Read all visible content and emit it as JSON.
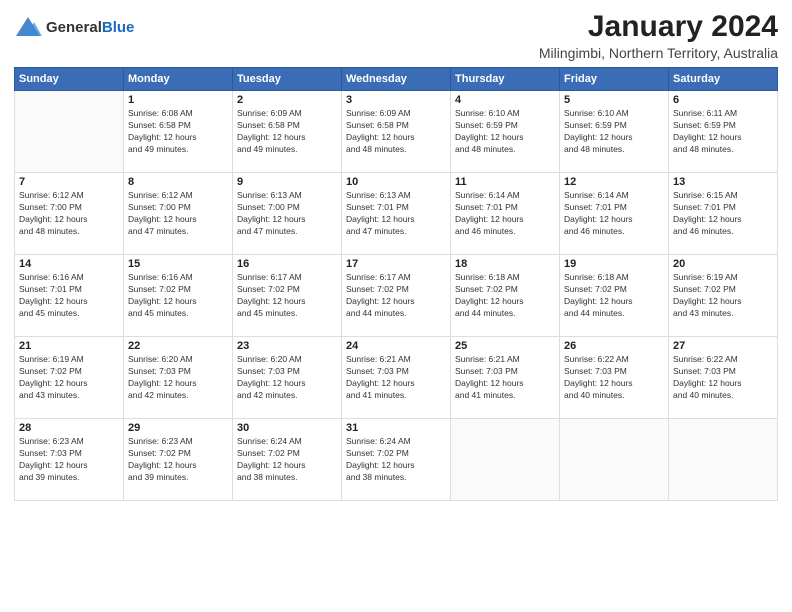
{
  "logo": {
    "general": "General",
    "blue": "Blue"
  },
  "title": "January 2024",
  "location": "Milingimbi, Northern Territory, Australia",
  "days_of_week": [
    "Sunday",
    "Monday",
    "Tuesday",
    "Wednesday",
    "Thursday",
    "Friday",
    "Saturday"
  ],
  "weeks": [
    [
      {
        "day": "",
        "info": ""
      },
      {
        "day": "1",
        "info": "Sunrise: 6:08 AM\nSunset: 6:58 PM\nDaylight: 12 hours\nand 49 minutes."
      },
      {
        "day": "2",
        "info": "Sunrise: 6:09 AM\nSunset: 6:58 PM\nDaylight: 12 hours\nand 49 minutes."
      },
      {
        "day": "3",
        "info": "Sunrise: 6:09 AM\nSunset: 6:58 PM\nDaylight: 12 hours\nand 48 minutes."
      },
      {
        "day": "4",
        "info": "Sunrise: 6:10 AM\nSunset: 6:59 PM\nDaylight: 12 hours\nand 48 minutes."
      },
      {
        "day": "5",
        "info": "Sunrise: 6:10 AM\nSunset: 6:59 PM\nDaylight: 12 hours\nand 48 minutes."
      },
      {
        "day": "6",
        "info": "Sunrise: 6:11 AM\nSunset: 6:59 PM\nDaylight: 12 hours\nand 48 minutes."
      }
    ],
    [
      {
        "day": "7",
        "info": "Sunrise: 6:12 AM\nSunset: 7:00 PM\nDaylight: 12 hours\nand 48 minutes."
      },
      {
        "day": "8",
        "info": "Sunrise: 6:12 AM\nSunset: 7:00 PM\nDaylight: 12 hours\nand 47 minutes."
      },
      {
        "day": "9",
        "info": "Sunrise: 6:13 AM\nSunset: 7:00 PM\nDaylight: 12 hours\nand 47 minutes."
      },
      {
        "day": "10",
        "info": "Sunrise: 6:13 AM\nSunset: 7:01 PM\nDaylight: 12 hours\nand 47 minutes."
      },
      {
        "day": "11",
        "info": "Sunrise: 6:14 AM\nSunset: 7:01 PM\nDaylight: 12 hours\nand 46 minutes."
      },
      {
        "day": "12",
        "info": "Sunrise: 6:14 AM\nSunset: 7:01 PM\nDaylight: 12 hours\nand 46 minutes."
      },
      {
        "day": "13",
        "info": "Sunrise: 6:15 AM\nSunset: 7:01 PM\nDaylight: 12 hours\nand 46 minutes."
      }
    ],
    [
      {
        "day": "14",
        "info": "Sunrise: 6:16 AM\nSunset: 7:01 PM\nDaylight: 12 hours\nand 45 minutes."
      },
      {
        "day": "15",
        "info": "Sunrise: 6:16 AM\nSunset: 7:02 PM\nDaylight: 12 hours\nand 45 minutes."
      },
      {
        "day": "16",
        "info": "Sunrise: 6:17 AM\nSunset: 7:02 PM\nDaylight: 12 hours\nand 45 minutes."
      },
      {
        "day": "17",
        "info": "Sunrise: 6:17 AM\nSunset: 7:02 PM\nDaylight: 12 hours\nand 44 minutes."
      },
      {
        "day": "18",
        "info": "Sunrise: 6:18 AM\nSunset: 7:02 PM\nDaylight: 12 hours\nand 44 minutes."
      },
      {
        "day": "19",
        "info": "Sunrise: 6:18 AM\nSunset: 7:02 PM\nDaylight: 12 hours\nand 44 minutes."
      },
      {
        "day": "20",
        "info": "Sunrise: 6:19 AM\nSunset: 7:02 PM\nDaylight: 12 hours\nand 43 minutes."
      }
    ],
    [
      {
        "day": "21",
        "info": "Sunrise: 6:19 AM\nSunset: 7:02 PM\nDaylight: 12 hours\nand 43 minutes."
      },
      {
        "day": "22",
        "info": "Sunrise: 6:20 AM\nSunset: 7:03 PM\nDaylight: 12 hours\nand 42 minutes."
      },
      {
        "day": "23",
        "info": "Sunrise: 6:20 AM\nSunset: 7:03 PM\nDaylight: 12 hours\nand 42 minutes."
      },
      {
        "day": "24",
        "info": "Sunrise: 6:21 AM\nSunset: 7:03 PM\nDaylight: 12 hours\nand 41 minutes."
      },
      {
        "day": "25",
        "info": "Sunrise: 6:21 AM\nSunset: 7:03 PM\nDaylight: 12 hours\nand 41 minutes."
      },
      {
        "day": "26",
        "info": "Sunrise: 6:22 AM\nSunset: 7:03 PM\nDaylight: 12 hours\nand 40 minutes."
      },
      {
        "day": "27",
        "info": "Sunrise: 6:22 AM\nSunset: 7:03 PM\nDaylight: 12 hours\nand 40 minutes."
      }
    ],
    [
      {
        "day": "28",
        "info": "Sunrise: 6:23 AM\nSunset: 7:03 PM\nDaylight: 12 hours\nand 39 minutes."
      },
      {
        "day": "29",
        "info": "Sunrise: 6:23 AM\nSunset: 7:02 PM\nDaylight: 12 hours\nand 39 minutes."
      },
      {
        "day": "30",
        "info": "Sunrise: 6:24 AM\nSunset: 7:02 PM\nDaylight: 12 hours\nand 38 minutes."
      },
      {
        "day": "31",
        "info": "Sunrise: 6:24 AM\nSunset: 7:02 PM\nDaylight: 12 hours\nand 38 minutes."
      },
      {
        "day": "",
        "info": ""
      },
      {
        "day": "",
        "info": ""
      },
      {
        "day": "",
        "info": ""
      }
    ]
  ]
}
